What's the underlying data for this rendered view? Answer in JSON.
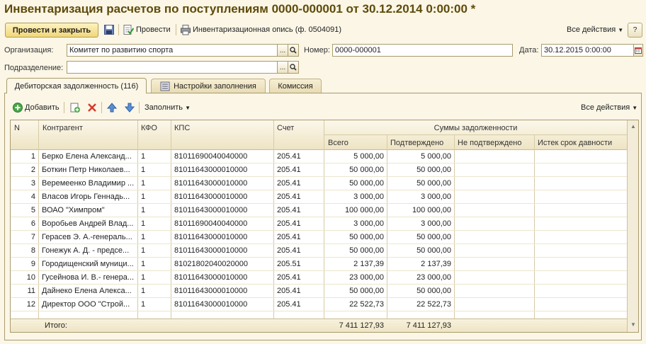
{
  "title": "Инвентаризация расчетов по поступлениям 0000-000001 от 30.12.2014 0:00:00 *",
  "toolbar": {
    "post_close": "Провести и закрыть",
    "post": "Провести",
    "print": "Инвентаризационная опись (ф. 0504091)",
    "all_actions": "Все действия",
    "help": "?"
  },
  "form": {
    "org_label": "Организация:",
    "org_value": "Комитет по развитию спорта",
    "number_label": "Номер:",
    "number_value": "0000-000001",
    "date_label": "Дата:",
    "date_value": "30.12.2015  0:00:00",
    "dept_label": "Подразделение:",
    "dept_value": "",
    "pick_button": "...",
    "search_icon": "search-icon"
  },
  "tabs": [
    {
      "label": "Дебиторская задолженность (116)",
      "active": true
    },
    {
      "label": "Настройки заполнения",
      "active": false
    },
    {
      "label": "Комиссия",
      "active": false
    }
  ],
  "table_toolbar": {
    "add": "Добавить",
    "fill": "Заполнить",
    "all_actions": "Все действия"
  },
  "table": {
    "headers": {
      "n": "N",
      "contractor": "Контрагент",
      "kfo": "КФО",
      "kps": "КПС",
      "account": "Счет",
      "sums_group": "Суммы задолженности",
      "total": "Всего",
      "confirmed": "Подтверждено",
      "not_confirmed": "Не подтверждено",
      "expired": "Истек срок давности"
    },
    "rows": [
      {
        "n": "1",
        "contractor": "Берко Елена Александ...",
        "kfo": "1",
        "kps": "81011690040040000",
        "account": "205.41",
        "total": "5 000,00",
        "confirmed": "5 000,00"
      },
      {
        "n": "2",
        "contractor": "Боткин Петр Николаев...",
        "kfo": "1",
        "kps": "81011643000010000",
        "account": "205.41",
        "total": "50 000,00",
        "confirmed": "50 000,00"
      },
      {
        "n": "3",
        "contractor": "Веремеенко Владимир ...",
        "kfo": "1",
        "kps": "81011643000010000",
        "account": "205.41",
        "total": "50 000,00",
        "confirmed": "50 000,00"
      },
      {
        "n": "4",
        "contractor": "Власов Игорь Геннадь...",
        "kfo": "1",
        "kps": "81011643000010000",
        "account": "205.41",
        "total": "3 000,00",
        "confirmed": "3 000,00"
      },
      {
        "n": "5",
        "contractor": "ВОАО \"Химпром\"",
        "kfo": "1",
        "kps": "81011643000010000",
        "account": "205.41",
        "total": "100 000,00",
        "confirmed": "100 000,00"
      },
      {
        "n": "6",
        "contractor": "Воробьев Андрей Влад...",
        "kfo": "1",
        "kps": "81011690040040000",
        "account": "205.41",
        "total": "3 000,00",
        "confirmed": "3 000,00"
      },
      {
        "n": "7",
        "contractor": "Герасев Э. А.-генераль...",
        "kfo": "1",
        "kps": "81011643000010000",
        "account": "205.41",
        "total": "50 000,00",
        "confirmed": "50 000,00"
      },
      {
        "n": "8",
        "contractor": "Гонежук А. Д. - предсе...",
        "kfo": "1",
        "kps": "81011643000010000",
        "account": "205.41",
        "total": "50 000,00",
        "confirmed": "50 000,00"
      },
      {
        "n": "9",
        "contractor": "Городищенский муници...",
        "kfo": "1",
        "kps": "81021802040020000",
        "account": "205.51",
        "total": "2 137,39",
        "confirmed": "2 137,39"
      },
      {
        "n": "10",
        "contractor": "Гусейнова И. В.- генера...",
        "kfo": "1",
        "kps": "81011643000010000",
        "account": "205.41",
        "total": "23 000,00",
        "confirmed": "23 000,00"
      },
      {
        "n": "11",
        "contractor": "Дайнеко Елена Алекса...",
        "kfo": "1",
        "kps": "81011643000010000",
        "account": "205.41",
        "total": "50 000,00",
        "confirmed": "50 000,00"
      },
      {
        "n": "12",
        "contractor": "Директор ООО \"Строй...",
        "kfo": "1",
        "kps": "81011643000010000",
        "account": "205.41",
        "total": "22 522,73",
        "confirmed": "22 522,73"
      }
    ],
    "footer": {
      "label": "Итого:",
      "total": "7 411 127,93",
      "confirmed": "7 411 127,93"
    }
  },
  "colors": {
    "background": "#fbf6e6",
    "title": "#5e4b0b",
    "accent_button": "#f0d77a"
  }
}
